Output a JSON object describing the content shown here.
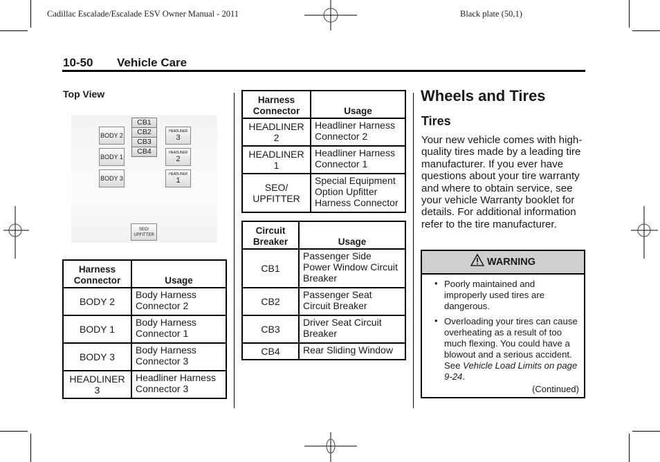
{
  "running_header": {
    "left": "Cadillac Escalade/Escalade ESV Owner Manual - 2011",
    "right": "Black plate (50,1)"
  },
  "section": {
    "page_number": "10-50",
    "title": "Vehicle Care"
  },
  "top_view": {
    "title": "Top View",
    "diagram": {
      "body_connectors": [
        "BODY 2",
        "BODY 1",
        "BODY 3"
      ],
      "circuit_breakers": [
        "CB1",
        "CB2",
        "CB3",
        "CB4"
      ],
      "headliner_connectors": [
        {
          "label": "HEADLINER",
          "number": "3"
        },
        {
          "label": "HEADLINER",
          "number": "2"
        },
        {
          "label": "HEADLINER",
          "number": "1"
        }
      ],
      "seo": {
        "line1": "SEO/",
        "line2": "UPFITTER"
      }
    }
  },
  "harness_table_1": {
    "headers": [
      "Harness Connector",
      "Usage"
    ],
    "rows": [
      {
        "connector": "BODY 2",
        "usage": "Body Harness Connector 2"
      },
      {
        "connector": "BODY 1",
        "usage": "Body Harness Connector 1"
      },
      {
        "connector": "BODY 3",
        "usage": "Body Harness Connector 3"
      },
      {
        "connector": "HEADLINER 3",
        "usage": "Headliner Harness Connector 3"
      }
    ]
  },
  "harness_table_2": {
    "headers": [
      "Harness Connector",
      "Usage"
    ],
    "rows": [
      {
        "connector": "HEADLINER 2",
        "usage": "Headliner Harness Connector 2"
      },
      {
        "connector": "HEADLINER 1",
        "usage": "Headliner Harness Connector 1"
      },
      {
        "connector": "SEO/ UPFITTER",
        "usage": "Special Equipment Option Upfitter Harness Connector"
      }
    ]
  },
  "breaker_table": {
    "headers": [
      "Circuit Breaker",
      "Usage"
    ],
    "rows": [
      {
        "breaker": "CB1",
        "usage": "Passenger Side Power Window Circuit Breaker"
      },
      {
        "breaker": "CB2",
        "usage": "Passenger Seat Circuit Breaker"
      },
      {
        "breaker": "CB3",
        "usage": "Driver Seat Circuit Breaker"
      },
      {
        "breaker": "CB4",
        "usage": "Rear Sliding Window"
      }
    ]
  },
  "wheels": {
    "heading": "Wheels and Tires",
    "subheading": "Tires",
    "paragraph": "Your new vehicle comes with high-quality tires made by a leading tire manufacturer. If you ever have questions about your tire warranty and where to obtain service, see your vehicle Warranty booklet for details. For additional information refer to the tire manufacturer."
  },
  "warning": {
    "icon": "warning-triangle-icon",
    "title": "WARNING",
    "items": [
      {
        "text": "Poorly maintained and improperly used tires are dangerous."
      },
      {
        "text": "Overloading your tires can cause overheating as a result of too much flexing. You could have a blowout and a serious accident. See ",
        "ref": "Vehicle Load Limits on page 9-24",
        "after": "."
      }
    ],
    "continued": "(Continued)"
  }
}
